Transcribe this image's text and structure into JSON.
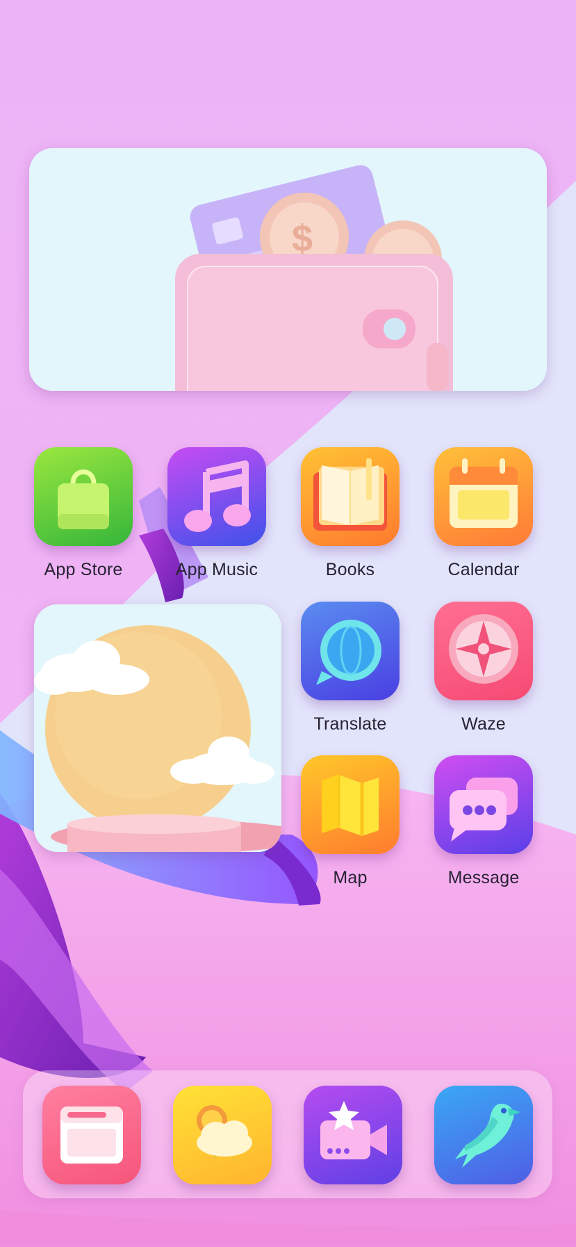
{
  "colors": {
    "background_pink": "#f4b1f4",
    "background_lavender": "#e2e4fb",
    "widget_bg": "#e2f6fb",
    "label_text": "#262233"
  },
  "home_grid": {
    "apps": [
      {
        "label": "App Store",
        "icon": "shopping-bag-icon"
      },
      {
        "label": "App Music",
        "icon": "music-note-icon"
      },
      {
        "label": "Books",
        "icon": "open-book-icon"
      },
      {
        "label": "Calendar",
        "icon": "calendar-icon"
      },
      {
        "label": "Translate",
        "icon": "globe-chat-icon"
      },
      {
        "label": "Waze",
        "icon": "compass-icon"
      },
      {
        "label": "Map",
        "icon": "folded-map-icon"
      },
      {
        "label": "Message",
        "icon": "chat-bubbles-icon"
      }
    ]
  },
  "widgets": [
    {
      "name": "wallet-widget",
      "image": "wallet-with-card-and-coins"
    },
    {
      "name": "sun-clouds-widget",
      "image": "sun-with-clouds-on-podium"
    }
  ],
  "dock": {
    "apps": [
      {
        "icon": "browser-window-icon"
      },
      {
        "icon": "weather-icon"
      },
      {
        "icon": "video-star-icon"
      },
      {
        "icon": "bird-icon"
      }
    ]
  }
}
